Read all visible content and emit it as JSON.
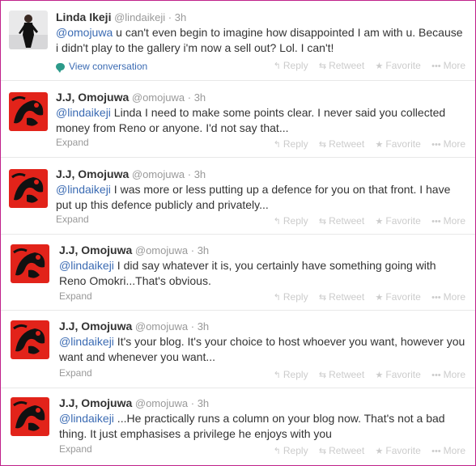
{
  "actions": {
    "reply": "Reply",
    "retweet": "Retweet",
    "favorite": "Favorite",
    "more": "More"
  },
  "tweets": [
    {
      "name": "Linda Ikeji",
      "handle": "@lindaikeji",
      "time": "3h",
      "mention": "@omojuwa",
      "line1": " u can't even begin to imagine how disappointed I am with u. Because",
      "line2": "i didn't play to the gallery i'm now a sell out? Lol. I can't!",
      "footer": "View conversation"
    },
    {
      "name": "J.J, Omojuwa",
      "handle": "@omojuwa",
      "time": "3h",
      "mention": "@lindaikeji",
      "line1": " Linda I need to make some points clear. I never said you collected",
      "line2": "money from Reno or anyone. I'd not say that...",
      "footer": "Expand"
    },
    {
      "name": "J.J, Omojuwa",
      "handle": "@omojuwa",
      "time": "3h",
      "mention": "@lindaikeji",
      "line1": " I was more or less putting up a defence for you on that front. I have",
      "line2": "put up this defence publicly and privately...",
      "footer": "Expand"
    },
    {
      "name": "J.J, Omojuwa",
      "handle": "@omojuwa",
      "time": "3h",
      "mention": "@lindaikeji",
      "line1": " I did say whatever it is, you certainly have something going with",
      "line2": "Reno Omokri...That's obvious.",
      "footer": "Expand"
    },
    {
      "name": "J.J, Omojuwa",
      "handle": "@omojuwa",
      "time": "3h",
      "mention": "@lindaikeji",
      "line1": " It's your blog. It's your choice to host whoever you want, however you",
      "line2": "want and whenever you want...",
      "footer": "Expand"
    },
    {
      "name": "J.J, Omojuwa",
      "handle": "@omojuwa",
      "time": "3h",
      "mention": "@lindaikeji",
      "line1": " ...He practically runs a column on your blog now. That's not a bad",
      "line2": "thing. It just  emphasises a privilege he enjoys with you",
      "footer": "Expand"
    }
  ]
}
